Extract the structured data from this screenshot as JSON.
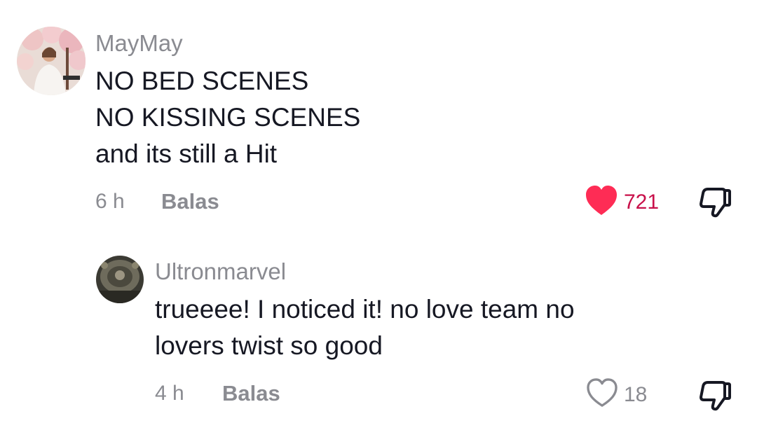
{
  "comments": [
    {
      "username": "MayMay",
      "lines": [
        "NO BED SCENES",
        "NO KISSING SCENES",
        "and its still a Hit"
      ],
      "time": "6 h",
      "reply_label": "Balas",
      "likes": "721",
      "liked": true
    },
    {
      "username": "Ultronmarvel",
      "lines": [
        "trueeee! I noticed it! no love team no",
        "lovers twist so good"
      ],
      "time": "4 h",
      "reply_label": "Balas",
      "likes": "18",
      "liked": false
    }
  ],
  "colors": {
    "liked_heart": "#fe2c55",
    "liked_count": "#c8104a",
    "muted_text": "#8a8b91",
    "primary_text": "#161823"
  },
  "icons": {
    "like": "heart-icon",
    "dislike": "thumbs-down-icon"
  }
}
